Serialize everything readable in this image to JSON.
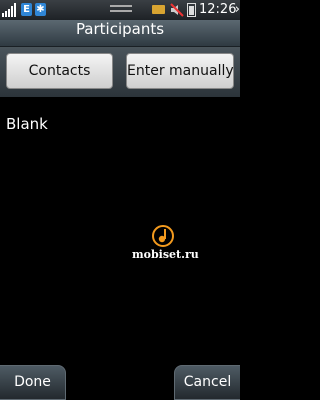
{
  "status_bar": {
    "time": "12:26",
    "edge_label": "E",
    "bluetooth_glyph": "✱",
    "more_glyph": "›",
    "icons": [
      "signal-icon",
      "edge-icon",
      "bluetooth-icon",
      "drag-handle-icon",
      "message-icon",
      "mute-icon",
      "battery-icon"
    ]
  },
  "header": {
    "title": "Participants"
  },
  "actions": {
    "contacts_label": "Contacts",
    "manual_label": "Enter manually"
  },
  "content": {
    "empty_text": "Blank"
  },
  "watermark": {
    "text": "mobiset.ru"
  },
  "footer": {
    "done_label": "Done",
    "cancel_label": "Cancel"
  },
  "colors": {
    "accent_blue": "#2f86d6",
    "watermark_orange": "#f39a1e",
    "title_bar": "#4a565e"
  }
}
